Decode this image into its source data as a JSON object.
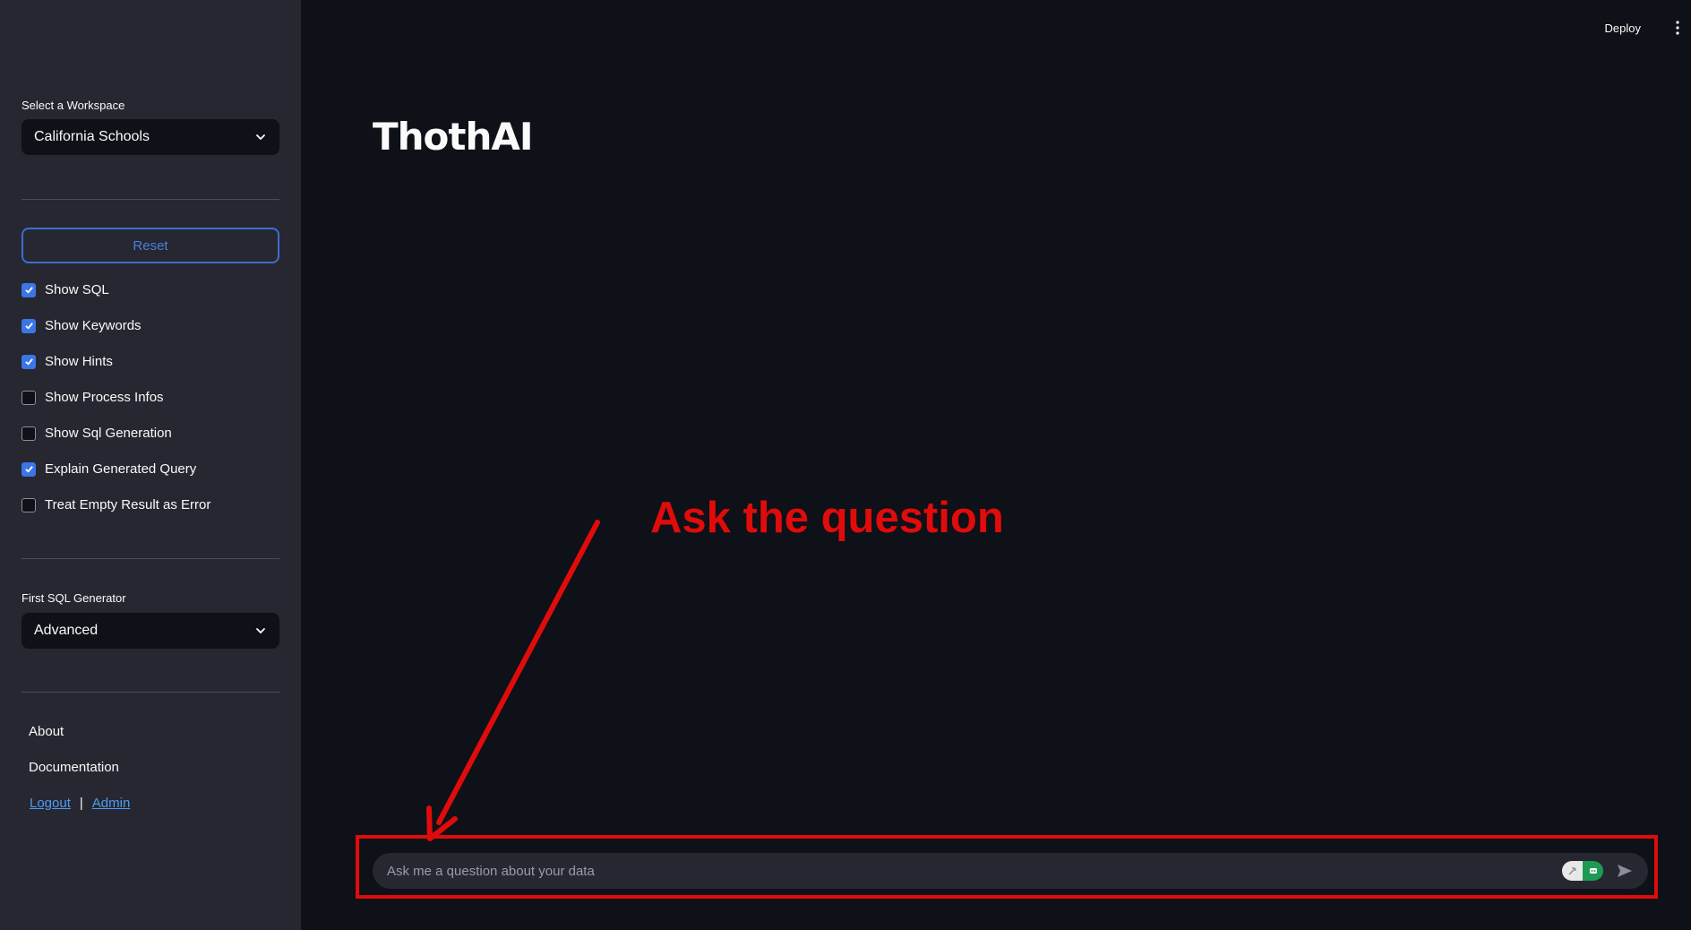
{
  "header": {
    "deploy_label": "Deploy",
    "menu_icon": "vertical-dots-icon"
  },
  "sidebar": {
    "workspace": {
      "label": "Select a Workspace",
      "selected": "California Schools"
    },
    "reset_label": "Reset",
    "options": [
      {
        "label": "Show SQL",
        "checked": true
      },
      {
        "label": "Show Keywords",
        "checked": true
      },
      {
        "label": "Show Hints",
        "checked": true
      },
      {
        "label": "Show Process Infos",
        "checked": false
      },
      {
        "label": "Show Sql Generation",
        "checked": false
      },
      {
        "label": "Explain Generated Query",
        "checked": true
      },
      {
        "label": "Treat Empty Result as Error",
        "checked": false
      }
    ],
    "generator": {
      "label": "First SQL Generator",
      "selected": "Advanced"
    },
    "links": {
      "about": "About",
      "documentation": "Documentation",
      "logout": "Logout",
      "separator": "|",
      "admin": "Admin"
    }
  },
  "main": {
    "title": "ThothAI",
    "annotation_text": "Ask the question",
    "chat": {
      "placeholder": "Ask me a question about your data"
    }
  },
  "colors": {
    "background": "#0e1117",
    "sidebar": "#262730",
    "accent": "#3b75e6",
    "annotation": "#e00b0b"
  }
}
